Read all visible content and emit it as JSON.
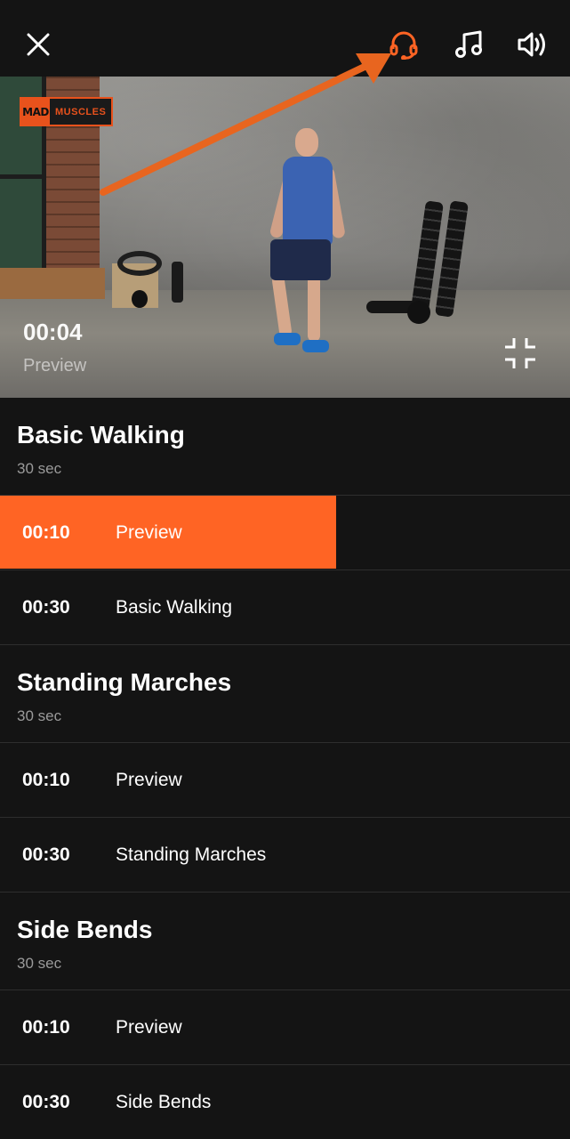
{
  "topbar": {
    "icons": [
      "close-icon",
      "headset-icon",
      "music-note-icon",
      "speaker-icon"
    ],
    "accent_color": "#ff6424"
  },
  "video": {
    "logo_left": "MAD",
    "logo_right": "MUSCLES",
    "elapsed": "00:04",
    "caption": "Preview"
  },
  "sections": [
    {
      "title": "Basic Walking",
      "duration": "30 sec",
      "rows": [
        {
          "time": "00:10",
          "label": "Preview",
          "progress": 0.59
        },
        {
          "time": "00:30",
          "label": "Basic Walking",
          "progress": 0
        }
      ]
    },
    {
      "title": "Standing Marches",
      "duration": "30 sec",
      "rows": [
        {
          "time": "00:10",
          "label": "Preview",
          "progress": 0
        },
        {
          "time": "00:30",
          "label": "Standing Marches",
          "progress": 0
        }
      ]
    },
    {
      "title": "Side Bends",
      "duration": "30 sec",
      "rows": [
        {
          "time": "00:10",
          "label": "Preview",
          "progress": 0
        },
        {
          "time": "00:30",
          "label": "Side Bends",
          "progress": 0
        }
      ]
    }
  ]
}
